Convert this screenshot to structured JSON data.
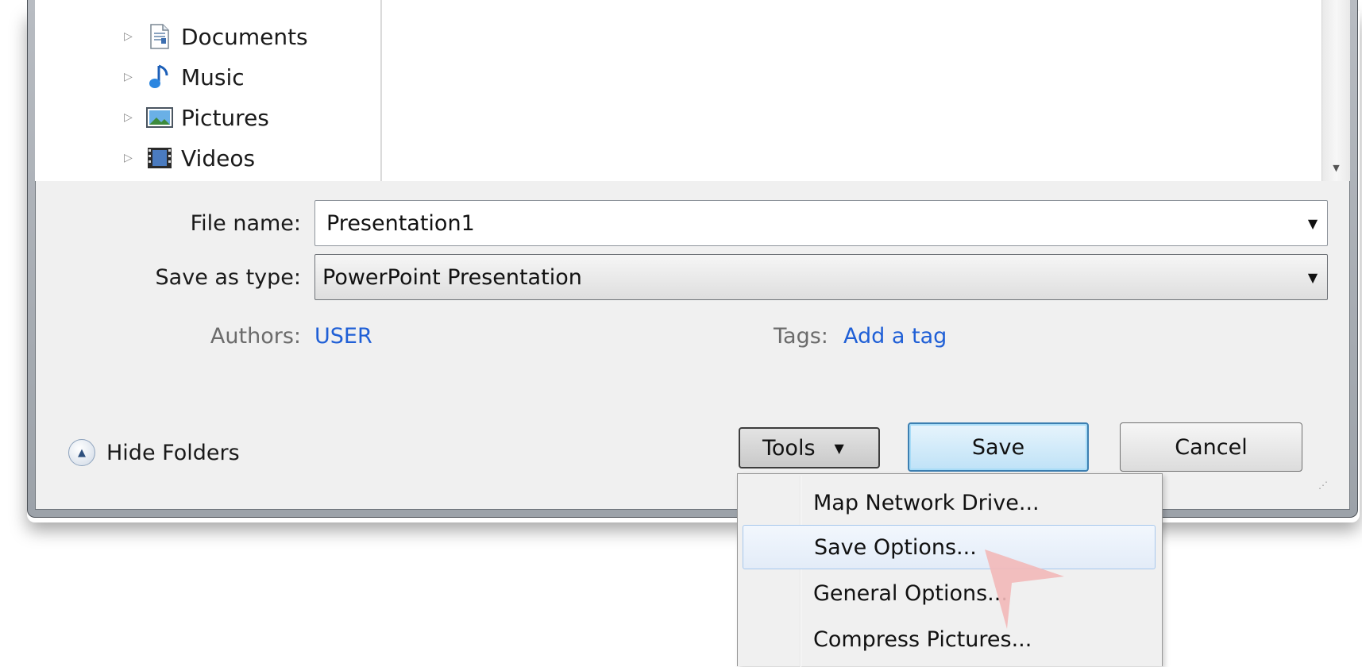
{
  "navigation": {
    "items": [
      {
        "label": "Documents",
        "icon": "documents-icon"
      },
      {
        "label": "Music",
        "icon": "music-icon"
      },
      {
        "label": "Pictures",
        "icon": "pictures-icon"
      },
      {
        "label": "Videos",
        "icon": "videos-icon"
      }
    ]
  },
  "form": {
    "file_name_label": "File name:",
    "file_name_value": "Presentation1",
    "save_type_label": "Save as type:",
    "save_type_value": "PowerPoint Presentation",
    "authors_label": "Authors:",
    "authors_value": "USER",
    "tags_label": "Tags:",
    "tags_value": "Add a tag"
  },
  "footer": {
    "hide_folders_label": "Hide Folders",
    "tools_label": "Tools",
    "save_label": "Save",
    "cancel_label": "Cancel"
  },
  "tools_menu": {
    "items": [
      {
        "label": "Map Network Drive...",
        "highlighted": false
      },
      {
        "label": "Save Options...",
        "highlighted": true
      },
      {
        "label": "General Options...",
        "highlighted": false
      },
      {
        "label": "Compress Pictures...",
        "highlighted": false
      }
    ]
  },
  "colors": {
    "link": "#1f5fd6",
    "save_button_border": "#3c7fb1",
    "menu_highlight_border": "#a8c8ec",
    "cursor": "#f2b8b8"
  }
}
